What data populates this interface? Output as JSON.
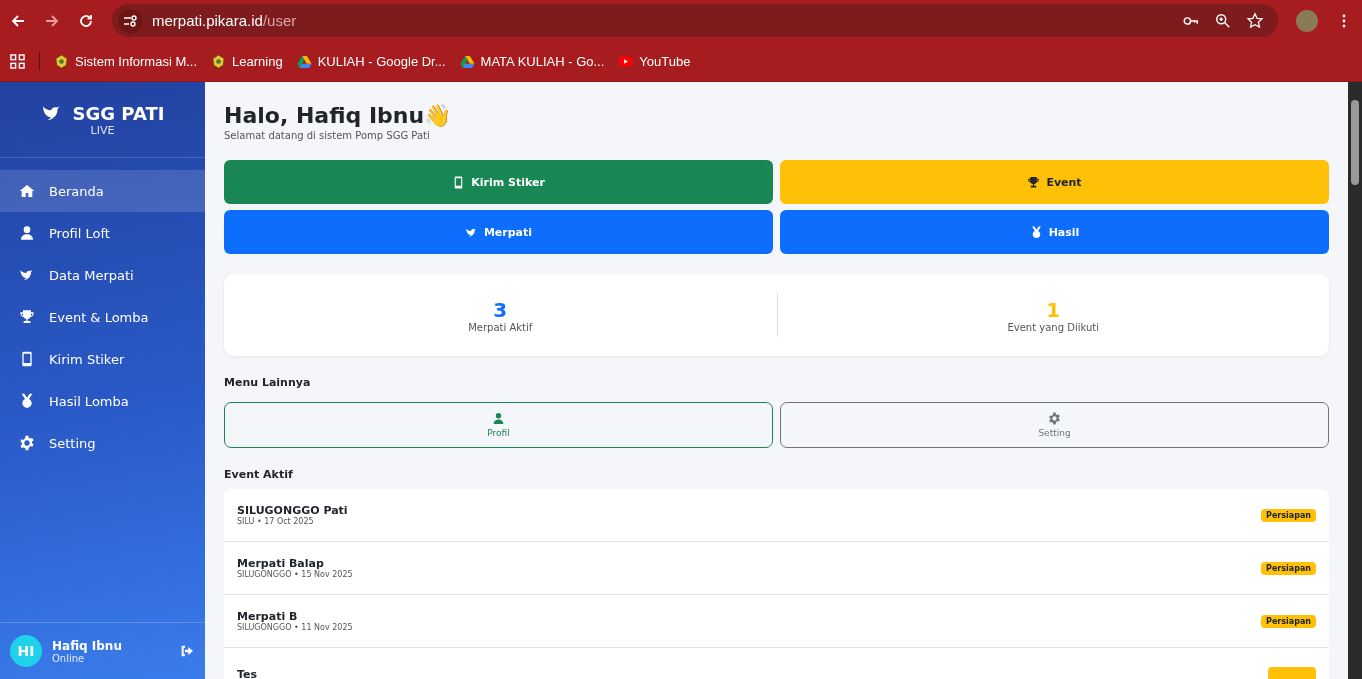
{
  "browser": {
    "url_host": "merpati.pikara.id",
    "url_path": "/user",
    "bookmarks": [
      {
        "label": "Sistem Informasi M...",
        "kind": "crest"
      },
      {
        "label": "Learning",
        "kind": "crest"
      },
      {
        "label": "KULIAH - Google Dr...",
        "kind": "drive"
      },
      {
        "label": "MATA KULIAH - Go...",
        "kind": "drive"
      },
      {
        "label": "YouTube",
        "kind": "youtube"
      }
    ]
  },
  "sidebar": {
    "brand": "SGG PATI",
    "subtitle": "LIVE",
    "items": [
      {
        "label": "Beranda",
        "kind": "home",
        "selected": true
      },
      {
        "label": "Profil Loft",
        "kind": "user",
        "selected": false
      },
      {
        "label": "Data Merpati",
        "kind": "bird",
        "selected": false
      },
      {
        "label": "Event & Lomba",
        "kind": "trophy",
        "selected": false
      },
      {
        "label": "Kirim Stiker",
        "kind": "phone",
        "selected": false
      },
      {
        "label": "Hasil Lomba",
        "kind": "medal",
        "selected": false
      },
      {
        "label": "Setting",
        "kind": "gear",
        "selected": false
      }
    ],
    "user": {
      "initials": "HI",
      "name": "Hafiq Ibnu",
      "status": "Online"
    }
  },
  "main": {
    "greeting": "Halo, Hafiq Ibnu👋",
    "subtitle": "Selamat datang di sistem Pomp SGG Pati",
    "actions": [
      {
        "label": "Kirim Stiker",
        "kind": "phone",
        "color": "#198754"
      },
      {
        "label": "Event",
        "kind": "trophy",
        "color": "#ffc107"
      },
      {
        "label": "Merpati",
        "kind": "bird",
        "color": "#0d6efd"
      },
      {
        "label": "Hasil",
        "kind": "medal",
        "color": "#0d6efd"
      }
    ],
    "stats": [
      {
        "value": "3",
        "label": "Merpati Aktif",
        "color": "#0d6efd"
      },
      {
        "value": "1",
        "label": "Event yang Diikuti",
        "color": "#ffc107"
      }
    ],
    "menu_title": "Menu Lainnya",
    "menu": [
      {
        "label": "Profil",
        "kind": "user",
        "color": "#198754"
      },
      {
        "label": "Setting",
        "kind": "gear",
        "color": "#6c757d"
      }
    ],
    "events_title": "Event Aktif",
    "events": [
      {
        "title": "SILUGONGGO Pati",
        "meta": "SILU • 17 Oct 2025",
        "status": "Persiapan"
      },
      {
        "title": "Merpati Balap",
        "meta": "SILUGONGGO • 15 Nov 2025",
        "status": "Persiapan"
      },
      {
        "title": "Merpati B",
        "meta": "SILUGONGGO • 11 Nov 2025",
        "status": "Persiapan"
      },
      {
        "title": "Tes"
      }
    ]
  }
}
